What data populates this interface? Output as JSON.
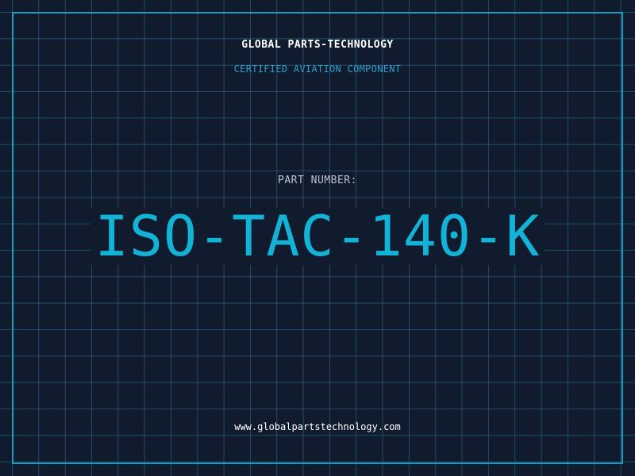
{
  "header": {
    "company": "GLOBAL PARTS-TECHNOLOGY",
    "subtitle": "CERTIFIED AVIATION COMPONENT"
  },
  "part": {
    "label": "PART NUMBER:",
    "number": "ISO-TAC-140-K"
  },
  "footer": {
    "url": "www.globalpartstechnology.com"
  },
  "colors": {
    "background": "#111b2e",
    "grid": "#28788f",
    "frame": "#1f9cc4",
    "accent": "#12b3d6",
    "subtitle": "#2a9fd0"
  }
}
